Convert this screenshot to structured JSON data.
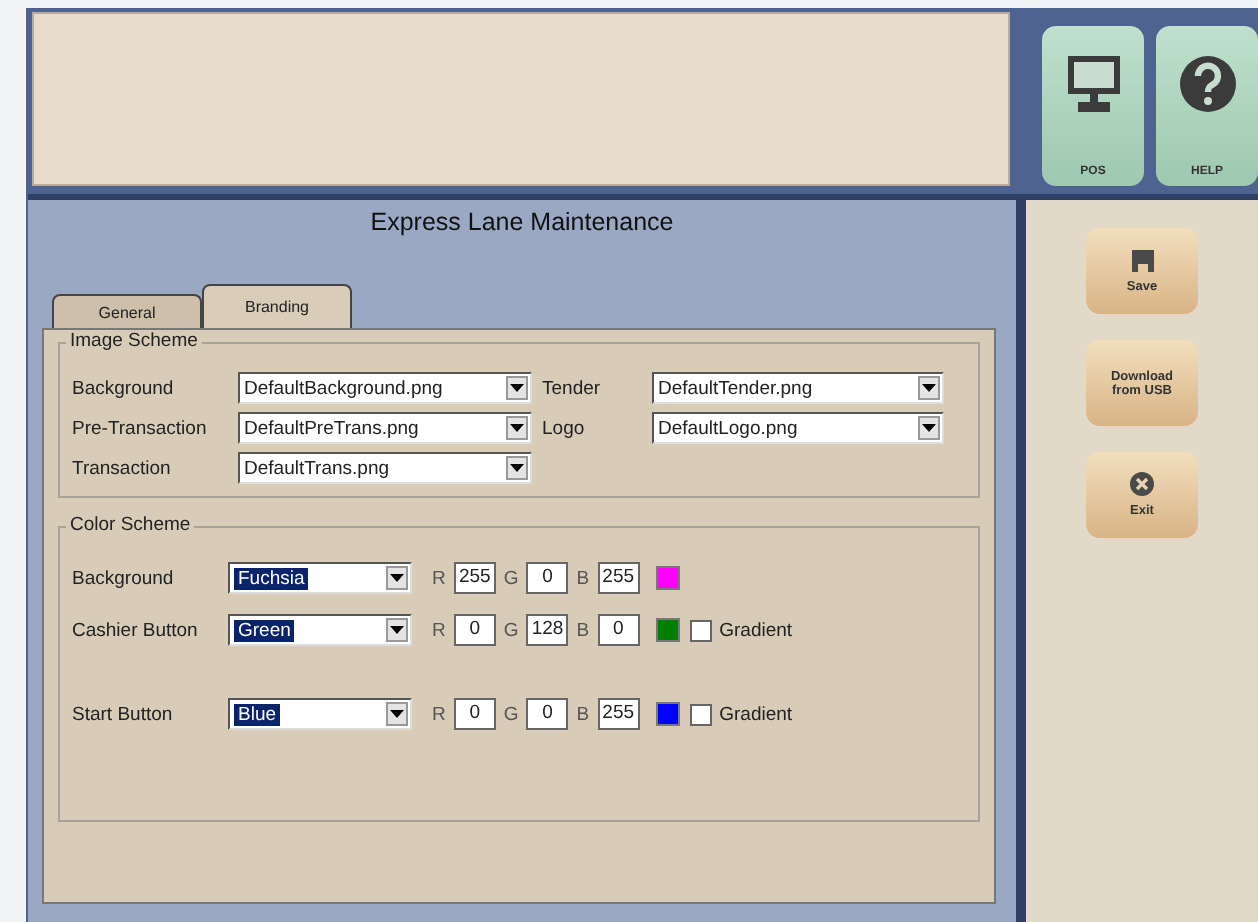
{
  "top_buttons": [
    {
      "label": "POS",
      "kind": "monitor"
    },
    {
      "label": "HELP",
      "kind": "help"
    }
  ],
  "title": "Express Lane Maintenance",
  "tabs": [
    {
      "label": "General",
      "selected": false
    },
    {
      "label": "Branding",
      "selected": true
    }
  ],
  "image_scheme": {
    "legend": "Image Scheme",
    "rows": [
      {
        "label": "Background",
        "value": "DefaultBackground.png"
      },
      {
        "label": "Tender",
        "value": "DefaultTender.png"
      },
      {
        "label": "Pre-Transaction",
        "value": "DefaultPreTrans.png"
      },
      {
        "label": "Logo",
        "value": "DefaultLogo.png"
      },
      {
        "label": "Transaction",
        "value": "DefaultTrans.png"
      }
    ]
  },
  "color_scheme": {
    "legend": "Color Scheme",
    "rows": [
      {
        "label": "Background",
        "value": "Fuchsia",
        "r_label": "R",
        "r": "255",
        "g_label": "G",
        "g": "0",
        "b_label": "B",
        "b": "255",
        "color": "#ff00ff"
      },
      {
        "label": "Cashier Button",
        "value": "Green",
        "r_label": "R",
        "r": "0",
        "g_label": "G",
        "g": "128",
        "b_label": "B",
        "b": "0",
        "color": "#008000",
        "gradient": {
          "label": "Gradient",
          "checked": false
        }
      },
      {
        "label": "Start Button",
        "value": "Blue",
        "r_label": "R",
        "r": "0",
        "g_label": "G",
        "g": "0",
        "b_label": "B",
        "b": "255",
        "color": "#0000ff",
        "gradient": {
          "label": "Gradient",
          "checked": false
        }
      }
    ]
  },
  "side_buttons": [
    {
      "label": "Save",
      "kind": "save"
    },
    {
      "label": "Download from USB",
      "kind": "text"
    },
    {
      "label": "Exit",
      "kind": "exit"
    }
  ]
}
